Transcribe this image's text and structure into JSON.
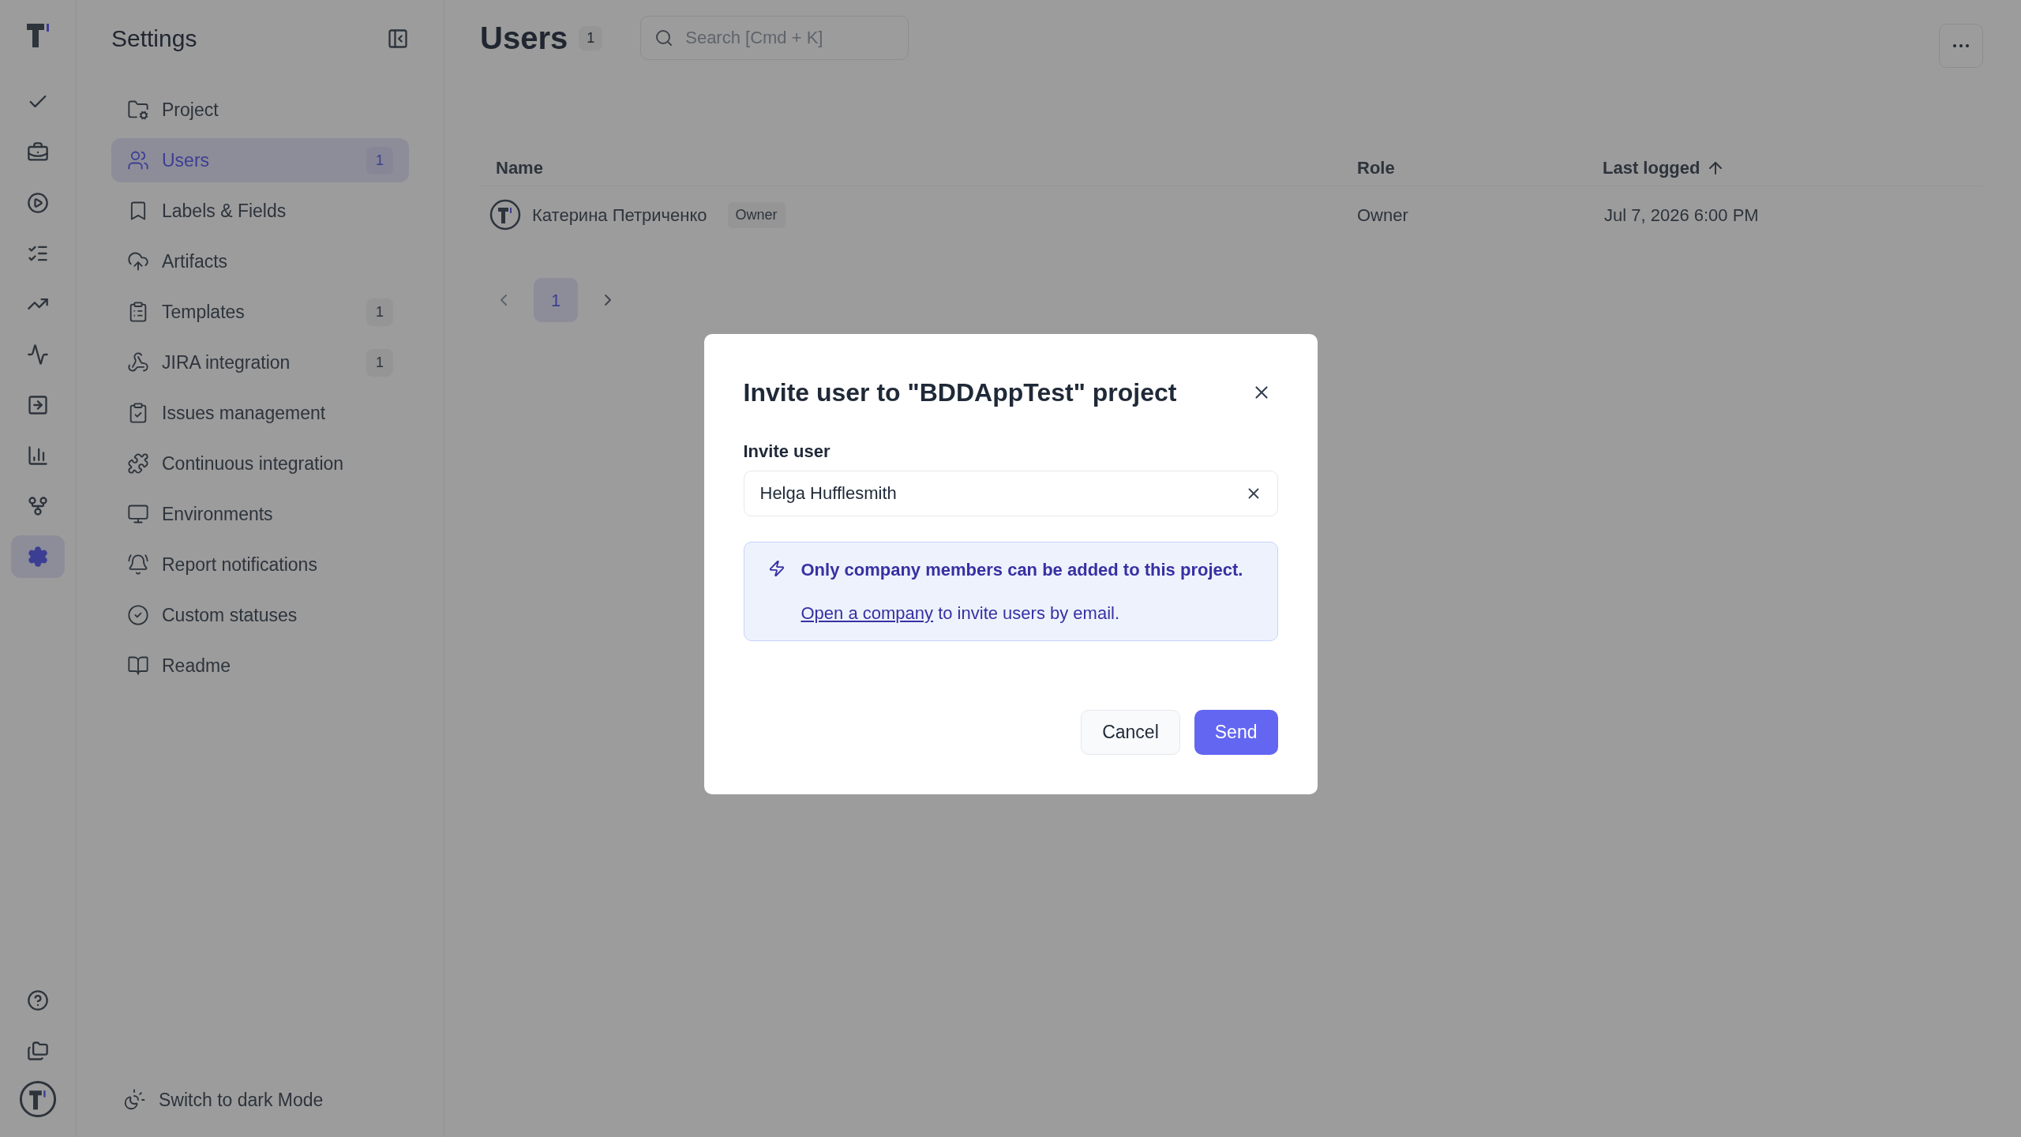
{
  "rail": {
    "items": [
      {
        "selected": false
      },
      {
        "selected": false
      },
      {
        "selected": false
      },
      {
        "selected": false
      },
      {
        "selected": false
      },
      {
        "selected": false
      },
      {
        "selected": false
      },
      {
        "selected": false
      },
      {
        "selected": false
      },
      {
        "selected": true
      }
    ],
    "bottom_items": [
      {
        "selected": false
      },
      {
        "selected": false
      }
    ]
  },
  "sidebar": {
    "title": "Settings",
    "items": [
      {
        "label": "Project",
        "selected": false
      },
      {
        "label": "Users",
        "selected": true,
        "count": "1"
      },
      {
        "label": "Labels & Fields",
        "selected": false
      },
      {
        "label": "Artifacts",
        "selected": false
      },
      {
        "label": "Templates",
        "selected": false,
        "count": "1"
      },
      {
        "label": "JIRA integration",
        "selected": false,
        "count": "1"
      },
      {
        "label": "Issues management",
        "selected": false
      },
      {
        "label": "Continuous integration",
        "selected": false
      },
      {
        "label": "Environments",
        "selected": false
      },
      {
        "label": "Report notifications",
        "selected": false
      },
      {
        "label": "Custom statuses",
        "selected": false
      },
      {
        "label": "Readme",
        "selected": false
      }
    ],
    "footer": "Switch to dark Mode"
  },
  "header": {
    "title": "Users",
    "count": "1",
    "search": {
      "placeholder": "Search [Cmd + K]"
    }
  },
  "table": {
    "columns": [
      "Name",
      "Role",
      "Last logged"
    ],
    "rows": [
      {
        "name": "Катерина Петриченко",
        "badge": "Owner",
        "role": "Owner",
        "last_logged": "Jul 7, 2026 6:00 PM"
      }
    ]
  },
  "pagination": {
    "pages": [
      {
        "label": "1",
        "selected": true
      }
    ]
  },
  "dialog": {
    "title": "Invite user to \"BDDAppTest\" project",
    "field_label": "Invite user",
    "value": "Helga Hufflesmith",
    "alert": {
      "title": "Only company members can be added to this project.",
      "link": "Open a company",
      "text": " to invite users by email."
    },
    "buttons": [
      {
        "label": "Cancel",
        "kind": "secondary"
      },
      {
        "label": "Send",
        "kind": "primary"
      }
    ]
  }
}
